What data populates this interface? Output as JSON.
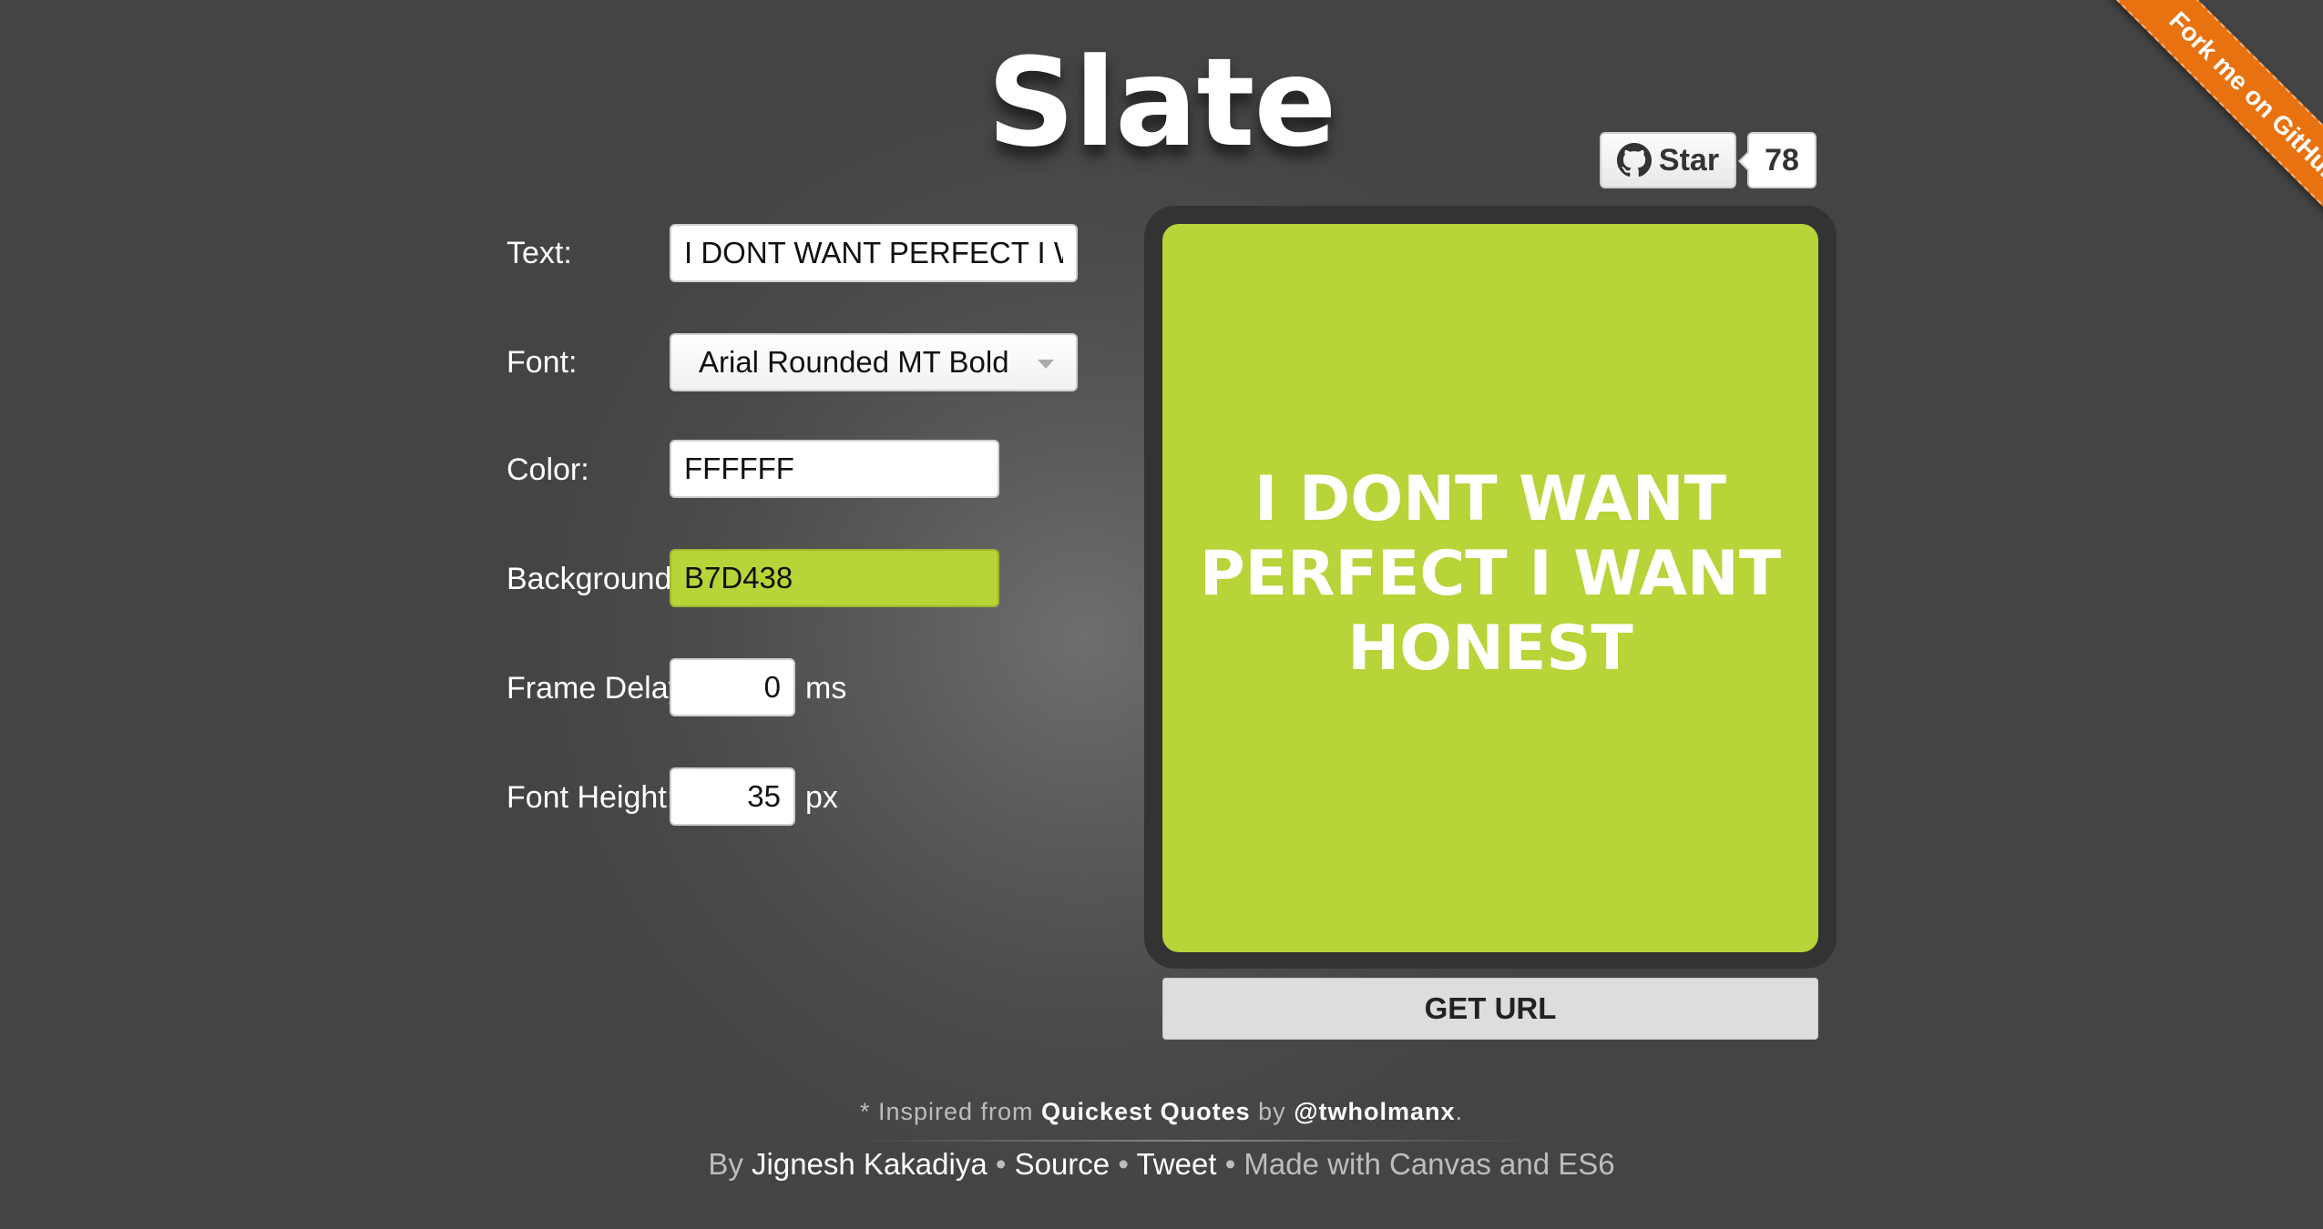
{
  "header": {
    "title": "Slate"
  },
  "github": {
    "star_label": "Star",
    "star_count": "78",
    "ribbon_label": "Fork me on GitHub",
    "ribbon_color": "#e8720f"
  },
  "form": {
    "text_label": "Text:",
    "text_value": "I DONT WANT PERFECT I WANT HONEST",
    "font_label": "Font:",
    "font_value": "Arial Rounded MT Bold",
    "color_label": "Color:",
    "color_value": "FFFFFF",
    "background_label": "Background:",
    "background_value": "B7D438",
    "frame_delay_label": "Frame Delay",
    "frame_delay_value": "0",
    "frame_delay_unit": "ms",
    "font_height_label": "Font Height:",
    "font_height_value": "35",
    "font_height_unit": "px"
  },
  "preview": {
    "text": "I DONT WANT PERFECT I WANT HONEST",
    "text_color": "#FFFFFF",
    "background_color": "#B7D438",
    "get_url_label": "GET URL"
  },
  "footer": {
    "inspired_prefix": "* Inspired from",
    "inspired_link": "Quickest Quotes",
    "inspired_by": "by",
    "inspired_author": "@twholmanx",
    "inspired_suffix": ".",
    "by_prefix": "By",
    "author_link": "Jignesh Kakadiya",
    "separator": "•",
    "source_link": "Source",
    "tweet_link": "Tweet",
    "made_with": "Made with Canvas and ES6"
  }
}
